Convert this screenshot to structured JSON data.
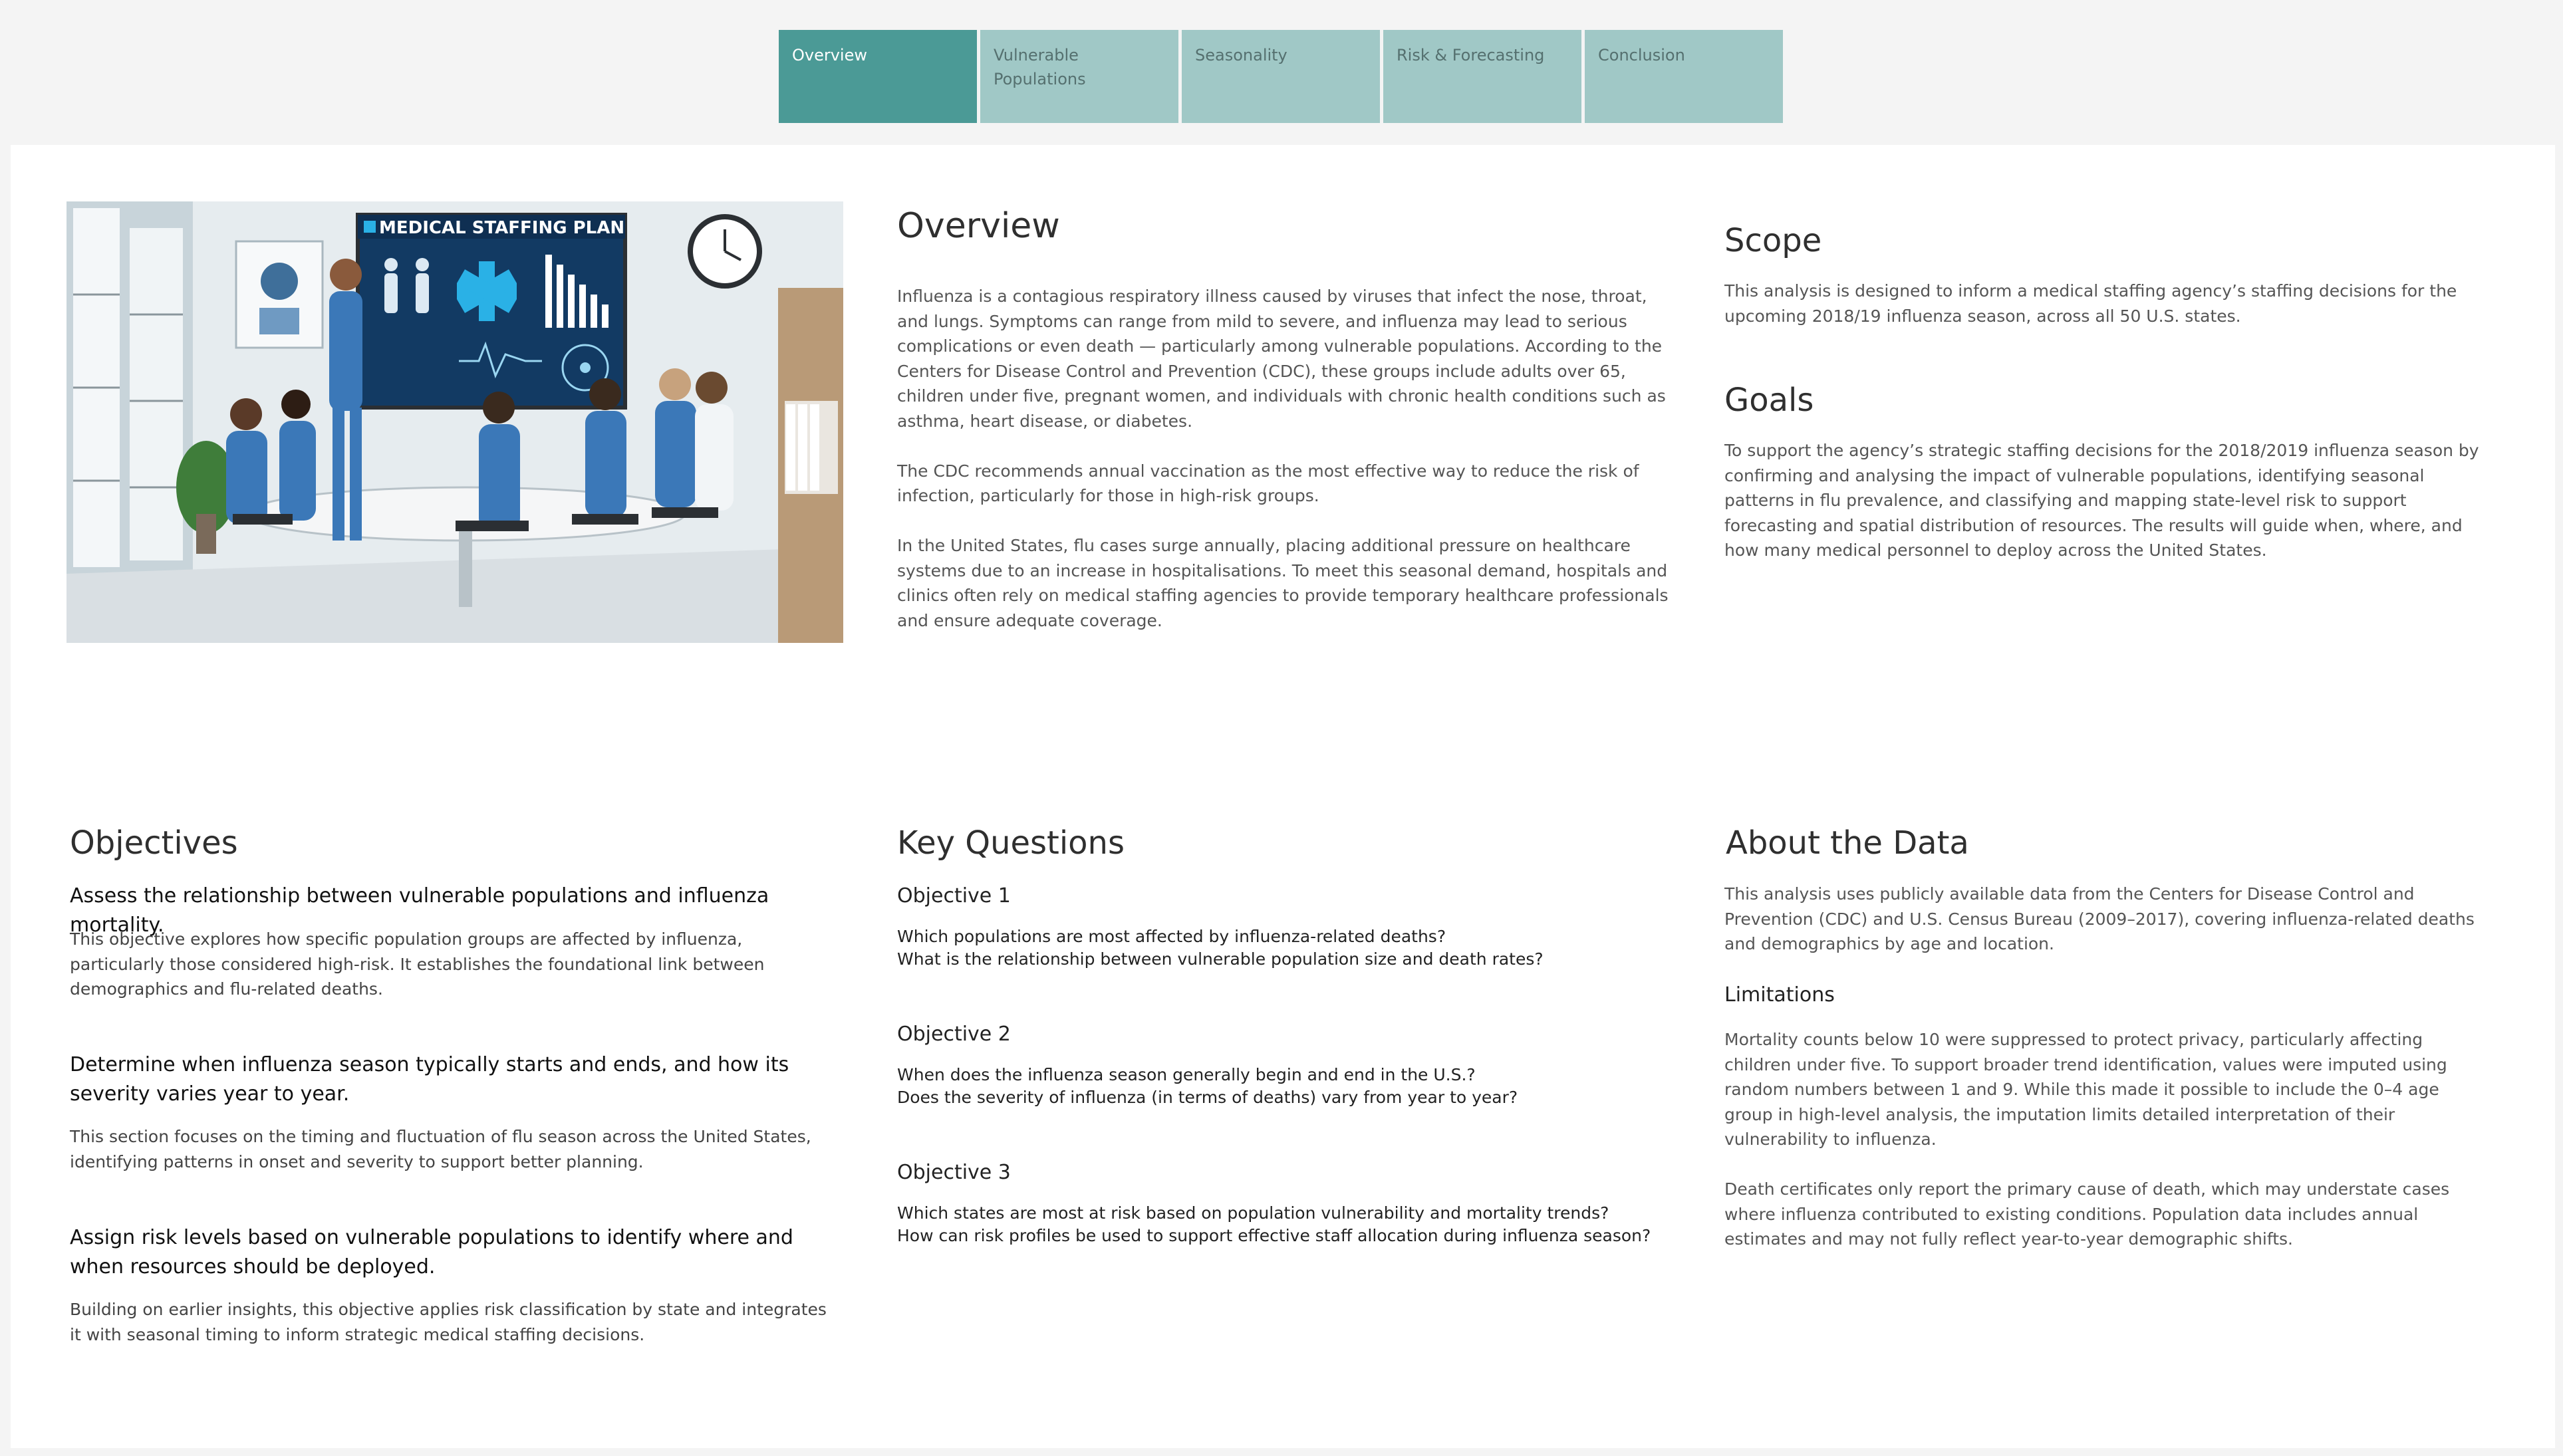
{
  "tabs": [
    {
      "label": "Overview"
    },
    {
      "label": "Vulnerable Populations"
    },
    {
      "label": "Seasonality"
    },
    {
      "label": "Risk & Forecasting"
    },
    {
      "label": "Conclusion"
    }
  ],
  "hero": {
    "banner": "MEDICAL STAFFING PLAN"
  },
  "overview": {
    "title": "Overview",
    "paragraphs": [
      "Influenza is a contagious respiratory illness caused by viruses that infect the nose, throat, and lungs. Symptoms can range from mild to severe, and influenza may lead to serious complications or even death — particularly among vulnerable populations. According to the Centers for Disease Control and Prevention (CDC), these groups include adults over 65, children under five, pregnant women, and individuals with chronic health conditions such as asthma, heart disease, or diabetes.",
      "The CDC recommends annual vaccination as the most effective way to reduce the risk of infection, particularly for those in high-risk groups.",
      "In the United States, flu cases surge annually, placing additional pressure on healthcare systems due to an increase in hospitalisations. To meet this seasonal demand, hospitals and clinics often rely on medical staffing agencies to provide temporary healthcare professionals and ensure adequate coverage."
    ]
  },
  "scope": {
    "title": "Scope",
    "text": "This analysis is designed to inform a medical staffing agency’s staffing decisions for the upcoming 2018/19 influenza season, across all 50 U.S. states."
  },
  "goals": {
    "title": "Goals",
    "text": "To support the agency’s strategic staffing decisions for the 2018/2019 influenza season by confirming and analysing the impact of vulnerable populations, identifying seasonal patterns in flu prevalence, and classifying and mapping state-level risk to support forecasting and spatial distribution of resources. The results will guide when, where, and how many medical personnel to deploy across the United States."
  },
  "objectives": {
    "title": "Objectives",
    "items": [
      {
        "title": "Assess the relationship between vulnerable populations and influenza mortality.",
        "text": "This objective explores how specific population groups are affected by influenza, particularly those considered high-risk. It establishes the foundational link between demographics and flu-related deaths."
      },
      {
        "title": "Determine when influenza season typically starts and ends, and how its severity varies year to year.",
        "text": "This section focuses on the timing and fluctuation of flu season across the United States, identifying patterns in onset and severity to support better planning."
      },
      {
        "title": "Assign risk levels based on vulnerable populations to identify where and when resources should be deployed.",
        "text": "Building on earlier insights, this objective applies risk classification by state and integrates it with seasonal timing to inform strategic medical staffing decisions."
      }
    ]
  },
  "key_questions": {
    "title": "Key Questions",
    "groups": [
      {
        "label": "Objective 1",
        "q1": "Which populations are most affected by influenza-related deaths?",
        "q2": "What is the relationship between vulnerable population size and death rates?"
      },
      {
        "label": "Objective 2",
        "q1": "When does the influenza season generally begin and end in the U.S.?",
        "q2": "Does the severity of influenza (in terms of deaths) vary from year to year?"
      },
      {
        "label": "Objective 3",
        "q1": "Which states are most at risk based on population vulnerability and mortality trends?",
        "q2": "How can risk profiles be used to support effective staff allocation during influenza season?"
      }
    ]
  },
  "about": {
    "title": "About the Data",
    "text": "This analysis uses publicly available data from the Centers for Disease Control and Prevention (CDC) and U.S. Census Bureau (2009–2017), covering influenza-related deaths and demographics by age and location.",
    "limitations_title": "Limitations",
    "limitations": [
      "Mortality counts below 10 were suppressed to protect privacy, particularly affecting children under five. To support broader trend identification, values were imputed using random numbers between 1 and 9. While this made it possible to include the 0–4 age group in high-level analysis, the imputation limits detailed interpretation of their vulnerability to influenza.",
      "Death certificates only report the primary cause of death, which may understate cases where influenza contributed to existing conditions. Population data includes annual estimates and may not fully reflect year-to-year demographic shifts."
    ]
  }
}
